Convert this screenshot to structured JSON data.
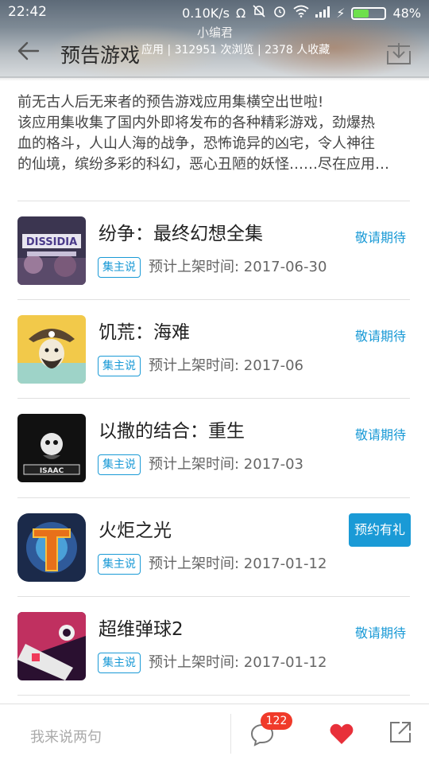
{
  "status_bar": {
    "time": "22:42",
    "network_speed": "0.10K/s",
    "battery": "48%",
    "battery_level": 0.48
  },
  "header": {
    "title": "预告游戏",
    "editor": "小编君",
    "stats": "应用 | 312951 次浏览 | 2378 人收藏"
  },
  "description": {
    "line1": "前无古人后无来者的预告游戏应用集横空出世啦!",
    "line2": "该应用集收集了国内外即将发布的各种精彩游戏，劲爆热",
    "line3": "血的格斗，人山人海的战争，恐怖诡异的凶宅，令人神往",
    "line4": "的仙境，缤纷多彩的科幻，恶心丑陋的妖怪……尽在应用…"
  },
  "games": [
    {
      "name": "纷争：最终幻想全集",
      "tag": "集主说",
      "release": "预计上架时间: 2017-06-30",
      "action": "敬请期待",
      "icon": "dissidia-icon"
    },
    {
      "name": "饥荒：海难",
      "tag": "集主说",
      "release": "预计上架时间: 2017-06",
      "action": "敬请期待",
      "icon": "pirate-icon"
    },
    {
      "name": "以撒的结合：重生",
      "tag": "集主说",
      "release": "预计上架时间: 2017-03",
      "action": "敬请期待",
      "icon": "isaac-icon"
    },
    {
      "name": "火炬之光",
      "tag": "集主说",
      "release": "预计上架时间: 2017-01-12",
      "action": "预约有礼",
      "icon": "torchlight-icon"
    },
    {
      "name": "超维弹球2",
      "tag": "集主说",
      "release": "预计上架时间: 2017-01-12",
      "action": "敬请期待",
      "icon": "pinball-icon"
    }
  ],
  "bottom_bar": {
    "comment_placeholder": "我来说两句",
    "comment_count": "122"
  },
  "colors": {
    "accent": "#1a9ad6",
    "badge": "#f03a2a",
    "heart": "#e8303a"
  }
}
